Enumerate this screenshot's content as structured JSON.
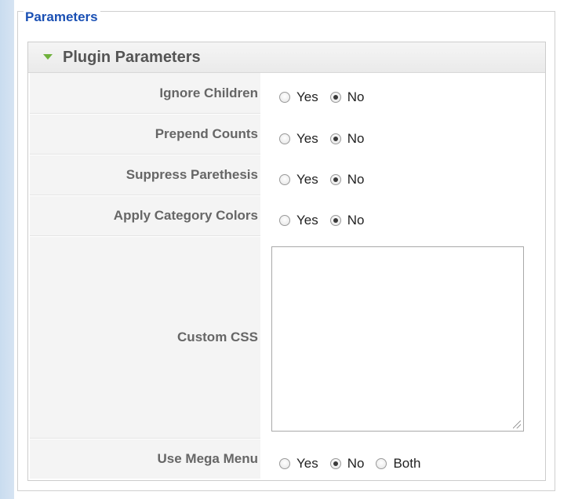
{
  "fieldset": {
    "legend": "Parameters"
  },
  "plugin": {
    "title": "Plugin Parameters"
  },
  "rows": [
    {
      "label": "Ignore Children",
      "options": [
        "Yes",
        "No"
      ],
      "selected": "No"
    },
    {
      "label": "Prepend Counts",
      "options": [
        "Yes",
        "No"
      ],
      "selected": "No"
    },
    {
      "label": "Suppress Parethesis",
      "options": [
        "Yes",
        "No"
      ],
      "selected": "No"
    },
    {
      "label": "Apply Category Colors",
      "options": [
        "Yes",
        "No"
      ],
      "selected": "No"
    },
    {
      "label": "Custom CSS",
      "type": "textarea",
      "value": ""
    },
    {
      "label": "Use Mega Menu",
      "options": [
        "Yes",
        "No",
        "Both"
      ],
      "selected": "No"
    }
  ],
  "colors": {
    "legend": "#1a50b4",
    "triangle": "#6fb13c",
    "label_text": "#666666"
  },
  "icons": {
    "collapse": "triangle-down-icon",
    "resize": "resize-grip-icon"
  }
}
